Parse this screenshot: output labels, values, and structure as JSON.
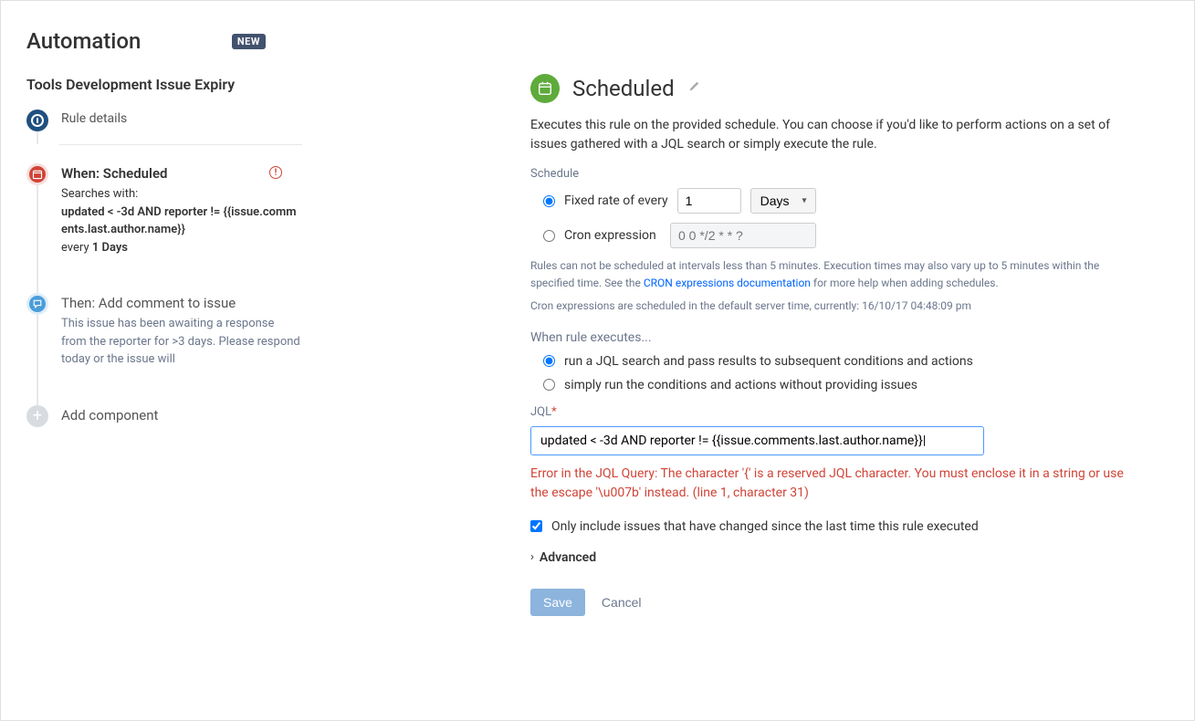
{
  "page": {
    "title": "Automation",
    "new_badge": "NEW"
  },
  "rule": {
    "name": "Tools Development Issue Expiry"
  },
  "timeline": {
    "rule_details": "Rule details",
    "when": {
      "title": "When: Scheduled",
      "searches_label": "Searches with:",
      "jql": "updated < -3d AND reporter != {{issue.comments.last.author.name}}",
      "freq_prefix": "every ",
      "freq_value": "1 Days"
    },
    "then": {
      "title": "Then: Add comment to issue",
      "desc": "This issue has been awaiting a response from the reporter for >3 days. Please respond today or the issue will"
    },
    "add_component": "Add component"
  },
  "detail": {
    "title": "Scheduled",
    "description": "Executes this rule on the provided schedule. You can choose if you'd like to perform actions on a set of issues gathered with a JQL search or simply execute the rule.",
    "schedule_label": "Schedule",
    "fixed_rate_label": "Fixed rate of every",
    "fixed_rate_value": "1",
    "fixed_rate_unit": "Days",
    "cron_label": "Cron expression",
    "cron_placeholder": "0 0 */2 * * ?",
    "help_sched_prefix": "Rules can not be scheduled at intervals less than 5 minutes. Execution times may also vary up to 5 minutes within the specified time. See the ",
    "help_sched_link": "CRON expressions documentation",
    "help_sched_suffix": " for more help when adding schedules.",
    "help_tz": "Cron expressions are scheduled in the default server time, currently: 16/10/17 04:48:09 pm",
    "exec_label": "When rule executes...",
    "exec_opt1": "run a JQL search and pass results to subsequent conditions and actions",
    "exec_opt2": "simply run the conditions and actions without providing issues",
    "jql_label": "JQL",
    "jql_value": "updated < -3d AND reporter != {{issue.comments.last.author.name}}|",
    "jql_error": "Error in the JQL Query: The character '{' is a reserved JQL character. You must enclose it in a string or use the escape '\\u007b' instead. (line 1, character 31)",
    "only_changed_label": "Only include issues that have changed since the last time this rule executed",
    "advanced_label": "Advanced",
    "save_label": "Save",
    "cancel_label": "Cancel"
  }
}
